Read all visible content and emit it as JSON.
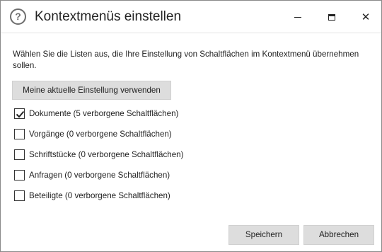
{
  "window": {
    "title": "Kontextmenüs einstellen",
    "help_icon": "question-circle-icon",
    "controls": {
      "minimize_icon": "minimize-icon",
      "maximize_icon": "maximize-icon",
      "close_glyph": "✕"
    }
  },
  "description": "Wählen Sie die Listen aus, die Ihre Einstellung von Schaltflächen im Kontextmenü übernehmen sollen.",
  "use_current_button": "Meine aktuelle Einstellung verwenden",
  "lists": [
    {
      "label": "Dokumente (5 verborgene Schaltflächen)",
      "checked": true
    },
    {
      "label": "Vorgänge (0 verborgene Schaltflächen)",
      "checked": false
    },
    {
      "label": "Schriftstücke (0 verborgene Schaltflächen)",
      "checked": false
    },
    {
      "label": "Anfragen (0 verborgene Schaltflächen)",
      "checked": false
    },
    {
      "label": "Beteiligte (0 verborgene Schaltflächen)",
      "checked": false
    }
  ],
  "footer": {
    "save_label": "Speichern",
    "cancel_label": "Abbrechen"
  },
  "colors": {
    "button_bg": "#dddddd",
    "text": "#222222",
    "window_border": "#8a8a8a"
  }
}
